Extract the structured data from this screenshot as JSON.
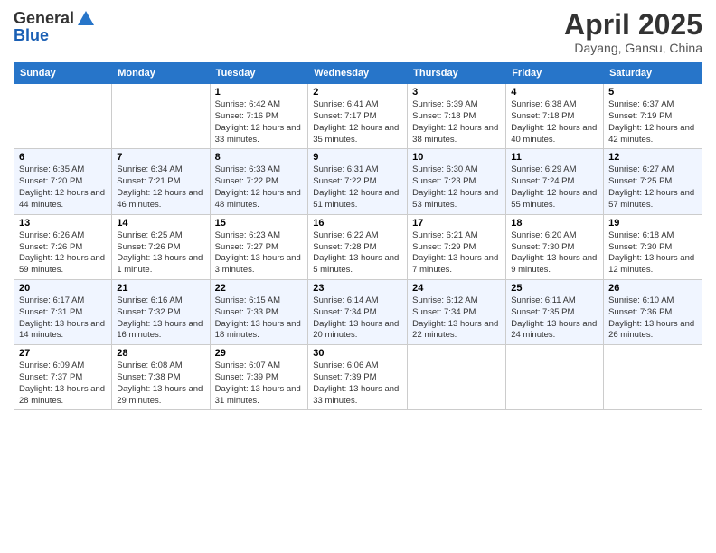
{
  "logo": {
    "general": "General",
    "blue": "Blue"
  },
  "header": {
    "month": "April 2025",
    "location": "Dayang, Gansu, China"
  },
  "weekdays": [
    "Sunday",
    "Monday",
    "Tuesday",
    "Wednesday",
    "Thursday",
    "Friday",
    "Saturday"
  ],
  "weeks": [
    [
      {
        "day": null
      },
      {
        "day": null
      },
      {
        "day": "1",
        "sunrise": "Sunrise: 6:42 AM",
        "sunset": "Sunset: 7:16 PM",
        "daylight": "Daylight: 12 hours and 33 minutes."
      },
      {
        "day": "2",
        "sunrise": "Sunrise: 6:41 AM",
        "sunset": "Sunset: 7:17 PM",
        "daylight": "Daylight: 12 hours and 35 minutes."
      },
      {
        "day": "3",
        "sunrise": "Sunrise: 6:39 AM",
        "sunset": "Sunset: 7:18 PM",
        "daylight": "Daylight: 12 hours and 38 minutes."
      },
      {
        "day": "4",
        "sunrise": "Sunrise: 6:38 AM",
        "sunset": "Sunset: 7:18 PM",
        "daylight": "Daylight: 12 hours and 40 minutes."
      },
      {
        "day": "5",
        "sunrise": "Sunrise: 6:37 AM",
        "sunset": "Sunset: 7:19 PM",
        "daylight": "Daylight: 12 hours and 42 minutes."
      }
    ],
    [
      {
        "day": "6",
        "sunrise": "Sunrise: 6:35 AM",
        "sunset": "Sunset: 7:20 PM",
        "daylight": "Daylight: 12 hours and 44 minutes."
      },
      {
        "day": "7",
        "sunrise": "Sunrise: 6:34 AM",
        "sunset": "Sunset: 7:21 PM",
        "daylight": "Daylight: 12 hours and 46 minutes."
      },
      {
        "day": "8",
        "sunrise": "Sunrise: 6:33 AM",
        "sunset": "Sunset: 7:22 PM",
        "daylight": "Daylight: 12 hours and 48 minutes."
      },
      {
        "day": "9",
        "sunrise": "Sunrise: 6:31 AM",
        "sunset": "Sunset: 7:22 PM",
        "daylight": "Daylight: 12 hours and 51 minutes."
      },
      {
        "day": "10",
        "sunrise": "Sunrise: 6:30 AM",
        "sunset": "Sunset: 7:23 PM",
        "daylight": "Daylight: 12 hours and 53 minutes."
      },
      {
        "day": "11",
        "sunrise": "Sunrise: 6:29 AM",
        "sunset": "Sunset: 7:24 PM",
        "daylight": "Daylight: 12 hours and 55 minutes."
      },
      {
        "day": "12",
        "sunrise": "Sunrise: 6:27 AM",
        "sunset": "Sunset: 7:25 PM",
        "daylight": "Daylight: 12 hours and 57 minutes."
      }
    ],
    [
      {
        "day": "13",
        "sunrise": "Sunrise: 6:26 AM",
        "sunset": "Sunset: 7:26 PM",
        "daylight": "Daylight: 12 hours and 59 minutes."
      },
      {
        "day": "14",
        "sunrise": "Sunrise: 6:25 AM",
        "sunset": "Sunset: 7:26 PM",
        "daylight": "Daylight: 13 hours and 1 minute."
      },
      {
        "day": "15",
        "sunrise": "Sunrise: 6:23 AM",
        "sunset": "Sunset: 7:27 PM",
        "daylight": "Daylight: 13 hours and 3 minutes."
      },
      {
        "day": "16",
        "sunrise": "Sunrise: 6:22 AM",
        "sunset": "Sunset: 7:28 PM",
        "daylight": "Daylight: 13 hours and 5 minutes."
      },
      {
        "day": "17",
        "sunrise": "Sunrise: 6:21 AM",
        "sunset": "Sunset: 7:29 PM",
        "daylight": "Daylight: 13 hours and 7 minutes."
      },
      {
        "day": "18",
        "sunrise": "Sunrise: 6:20 AM",
        "sunset": "Sunset: 7:30 PM",
        "daylight": "Daylight: 13 hours and 9 minutes."
      },
      {
        "day": "19",
        "sunrise": "Sunrise: 6:18 AM",
        "sunset": "Sunset: 7:30 PM",
        "daylight": "Daylight: 13 hours and 12 minutes."
      }
    ],
    [
      {
        "day": "20",
        "sunrise": "Sunrise: 6:17 AM",
        "sunset": "Sunset: 7:31 PM",
        "daylight": "Daylight: 13 hours and 14 minutes."
      },
      {
        "day": "21",
        "sunrise": "Sunrise: 6:16 AM",
        "sunset": "Sunset: 7:32 PM",
        "daylight": "Daylight: 13 hours and 16 minutes."
      },
      {
        "day": "22",
        "sunrise": "Sunrise: 6:15 AM",
        "sunset": "Sunset: 7:33 PM",
        "daylight": "Daylight: 13 hours and 18 minutes."
      },
      {
        "day": "23",
        "sunrise": "Sunrise: 6:14 AM",
        "sunset": "Sunset: 7:34 PM",
        "daylight": "Daylight: 13 hours and 20 minutes."
      },
      {
        "day": "24",
        "sunrise": "Sunrise: 6:12 AM",
        "sunset": "Sunset: 7:34 PM",
        "daylight": "Daylight: 13 hours and 22 minutes."
      },
      {
        "day": "25",
        "sunrise": "Sunrise: 6:11 AM",
        "sunset": "Sunset: 7:35 PM",
        "daylight": "Daylight: 13 hours and 24 minutes."
      },
      {
        "day": "26",
        "sunrise": "Sunrise: 6:10 AM",
        "sunset": "Sunset: 7:36 PM",
        "daylight": "Daylight: 13 hours and 26 minutes."
      }
    ],
    [
      {
        "day": "27",
        "sunrise": "Sunrise: 6:09 AM",
        "sunset": "Sunset: 7:37 PM",
        "daylight": "Daylight: 13 hours and 28 minutes."
      },
      {
        "day": "28",
        "sunrise": "Sunrise: 6:08 AM",
        "sunset": "Sunset: 7:38 PM",
        "daylight": "Daylight: 13 hours and 29 minutes."
      },
      {
        "day": "29",
        "sunrise": "Sunrise: 6:07 AM",
        "sunset": "Sunset: 7:39 PM",
        "daylight": "Daylight: 13 hours and 31 minutes."
      },
      {
        "day": "30",
        "sunrise": "Sunrise: 6:06 AM",
        "sunset": "Sunset: 7:39 PM",
        "daylight": "Daylight: 13 hours and 33 minutes."
      },
      {
        "day": null
      },
      {
        "day": null
      },
      {
        "day": null
      }
    ]
  ]
}
